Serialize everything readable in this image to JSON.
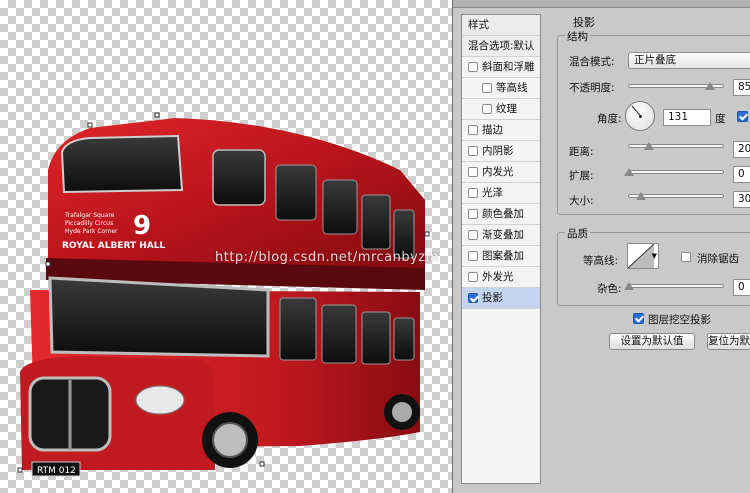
{
  "watermark": "http://blog.csdn.net/mrcanbyzm",
  "bus": {
    "destination_line1": "Trafalgar Square",
    "destination_line2": "Piccadilly Circus",
    "destination_line3": "Hyde Park Corner",
    "route_number": "9",
    "ad_text": "ROYAL ALBERT HALL",
    "plate": "RTM 012"
  },
  "style_list": {
    "header": "样式",
    "blend_options": "混合选项:默认",
    "items": [
      {
        "label": "斜面和浮雕",
        "checked": false,
        "indent": false,
        "selected": false
      },
      {
        "label": "等高线",
        "checked": false,
        "indent": true,
        "selected": false
      },
      {
        "label": "纹理",
        "checked": false,
        "indent": true,
        "selected": false
      },
      {
        "label": "描边",
        "checked": false,
        "indent": false,
        "selected": false
      },
      {
        "label": "内阴影",
        "checked": false,
        "indent": false,
        "selected": false
      },
      {
        "label": "内发光",
        "checked": false,
        "indent": false,
        "selected": false
      },
      {
        "label": "光泽",
        "checked": false,
        "indent": false,
        "selected": false
      },
      {
        "label": "颜色叠加",
        "checked": false,
        "indent": false,
        "selected": false
      },
      {
        "label": "渐变叠加",
        "checked": false,
        "indent": false,
        "selected": false
      },
      {
        "label": "图案叠加",
        "checked": false,
        "indent": false,
        "selected": false
      },
      {
        "label": "外发光",
        "checked": false,
        "indent": false,
        "selected": false
      },
      {
        "label": "投影",
        "checked": true,
        "indent": false,
        "selected": true
      }
    ]
  },
  "drop_shadow": {
    "title": "投影",
    "structure_label": "结构",
    "blend_mode_label": "混合模式:",
    "blend_mode_value": "正片叠底",
    "opacity_label": "不透明度:",
    "opacity_value": "85",
    "opacity_fraction": 0.85,
    "angle_label": "角度:",
    "angle_value": "131",
    "angle_unit": "度",
    "distance_label": "距离:",
    "distance_value": "20",
    "spread_label": "扩展:",
    "spread_value": "0",
    "size_label": "大小:",
    "size_value": "30",
    "quality_label": "品质",
    "contour_label": "等高线:",
    "antialias_label": "消除锯齿",
    "noise_label": "杂色:",
    "noise_value": "0",
    "knockout_label": "图层挖空投影",
    "set_default_button": "设置为默认值",
    "reset_default_button": "复位为默认值"
  }
}
